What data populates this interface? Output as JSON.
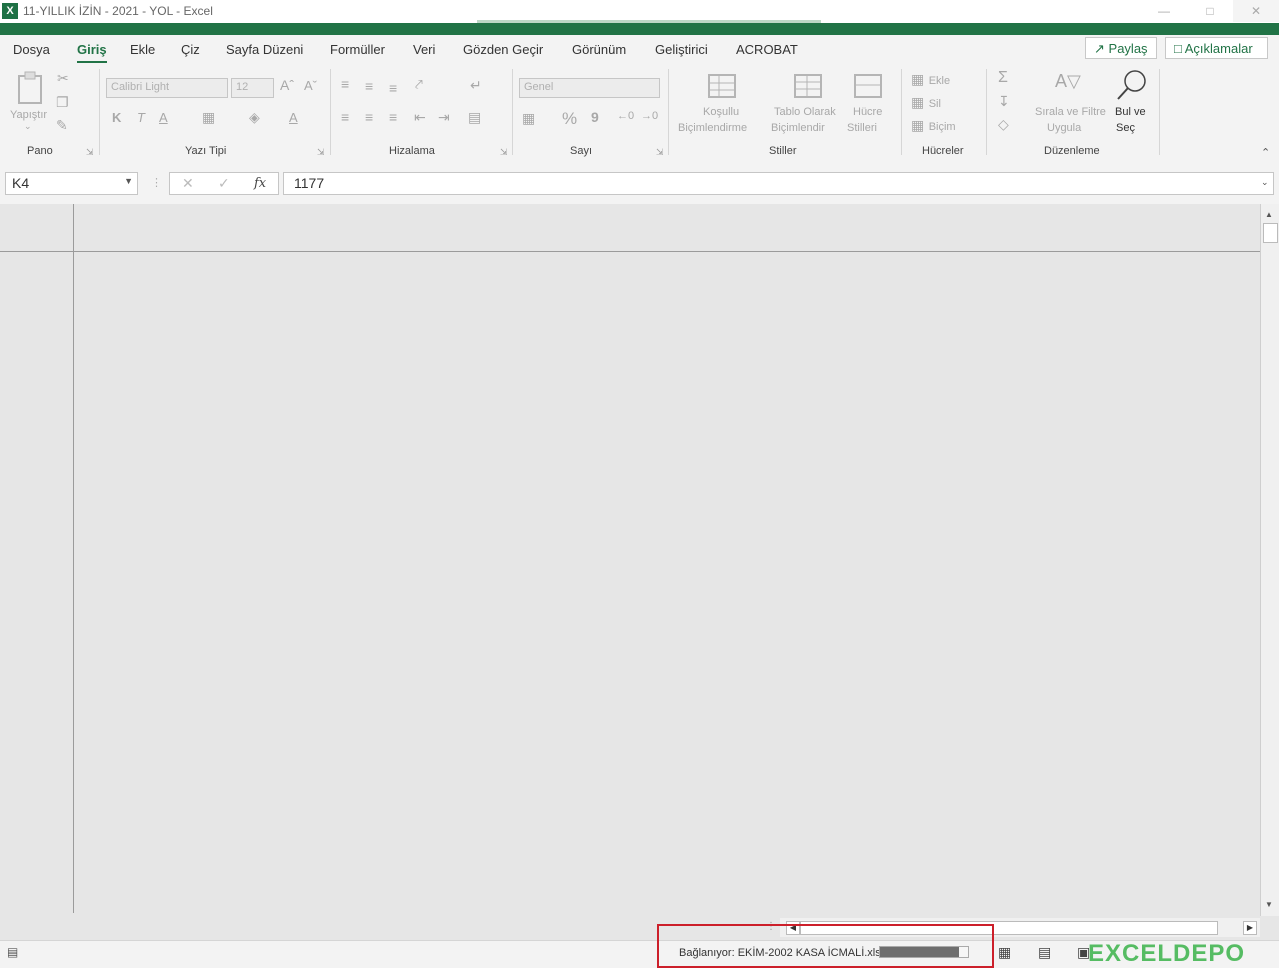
{
  "window": {
    "title": "11-YILLIK İZİN - 2021 - YOL - Excel",
    "app_icon_letter": "X",
    "accent": "#217346"
  },
  "tabs": [
    {
      "label": "Dosya"
    },
    {
      "label": "Giriş",
      "active": true
    },
    {
      "label": "Ekle"
    },
    {
      "label": "Çiz"
    },
    {
      "label": "Sayfa Düzeni"
    },
    {
      "label": "Formüller"
    },
    {
      "label": "Veri"
    },
    {
      "label": "Gözden Geçir"
    },
    {
      "label": "Görünüm"
    },
    {
      "label": "Geliştirici"
    },
    {
      "label": "ACROBAT"
    }
  ],
  "header_buttons": {
    "share": "Paylaş",
    "comments": "Açıklamalar"
  },
  "ribbon": {
    "clipboard": {
      "group_label": "Pano",
      "paste_label": "Yapıştır"
    },
    "font": {
      "group_label": "Yazı Tipi",
      "font_name": "Calibri Light",
      "font_size": "12",
      "bold": "K",
      "italic": "T",
      "underline": "A",
      "font_color": "A"
    },
    "alignment": {
      "group_label": "Hizalama"
    },
    "number": {
      "group_label": "Sayı",
      "format": "Genel",
      "percent": "%",
      "comma": "9"
    },
    "styles": {
      "group_label": "Stiller",
      "conditional_1": "Koşullu",
      "conditional_2": "Biçimlendirme",
      "table_1": "Tablo Olarak",
      "table_2": "Biçimlendir",
      "cell_1": "Hücre",
      "cell_2": "Stilleri"
    },
    "cells": {
      "group_label": "Hücreler",
      "insert": "Ekle",
      "delete": "Sil",
      "format": "Biçim"
    },
    "editing": {
      "group_label": "Düzenleme",
      "sort_1": "Sırala ve Filtre",
      "sort_2": "Uygula",
      "find_1": "Bul ve",
      "find_2": "Seç"
    }
  },
  "formula_bar": {
    "name_box": "K4",
    "fx": "fx",
    "content": "1177"
  },
  "status": {
    "connecting_text": "Bağlanıyor: EKİM-2002 KASA İCMALİ.xls",
    "progress": 0.9
  },
  "watermark": "EXCELDEPO"
}
